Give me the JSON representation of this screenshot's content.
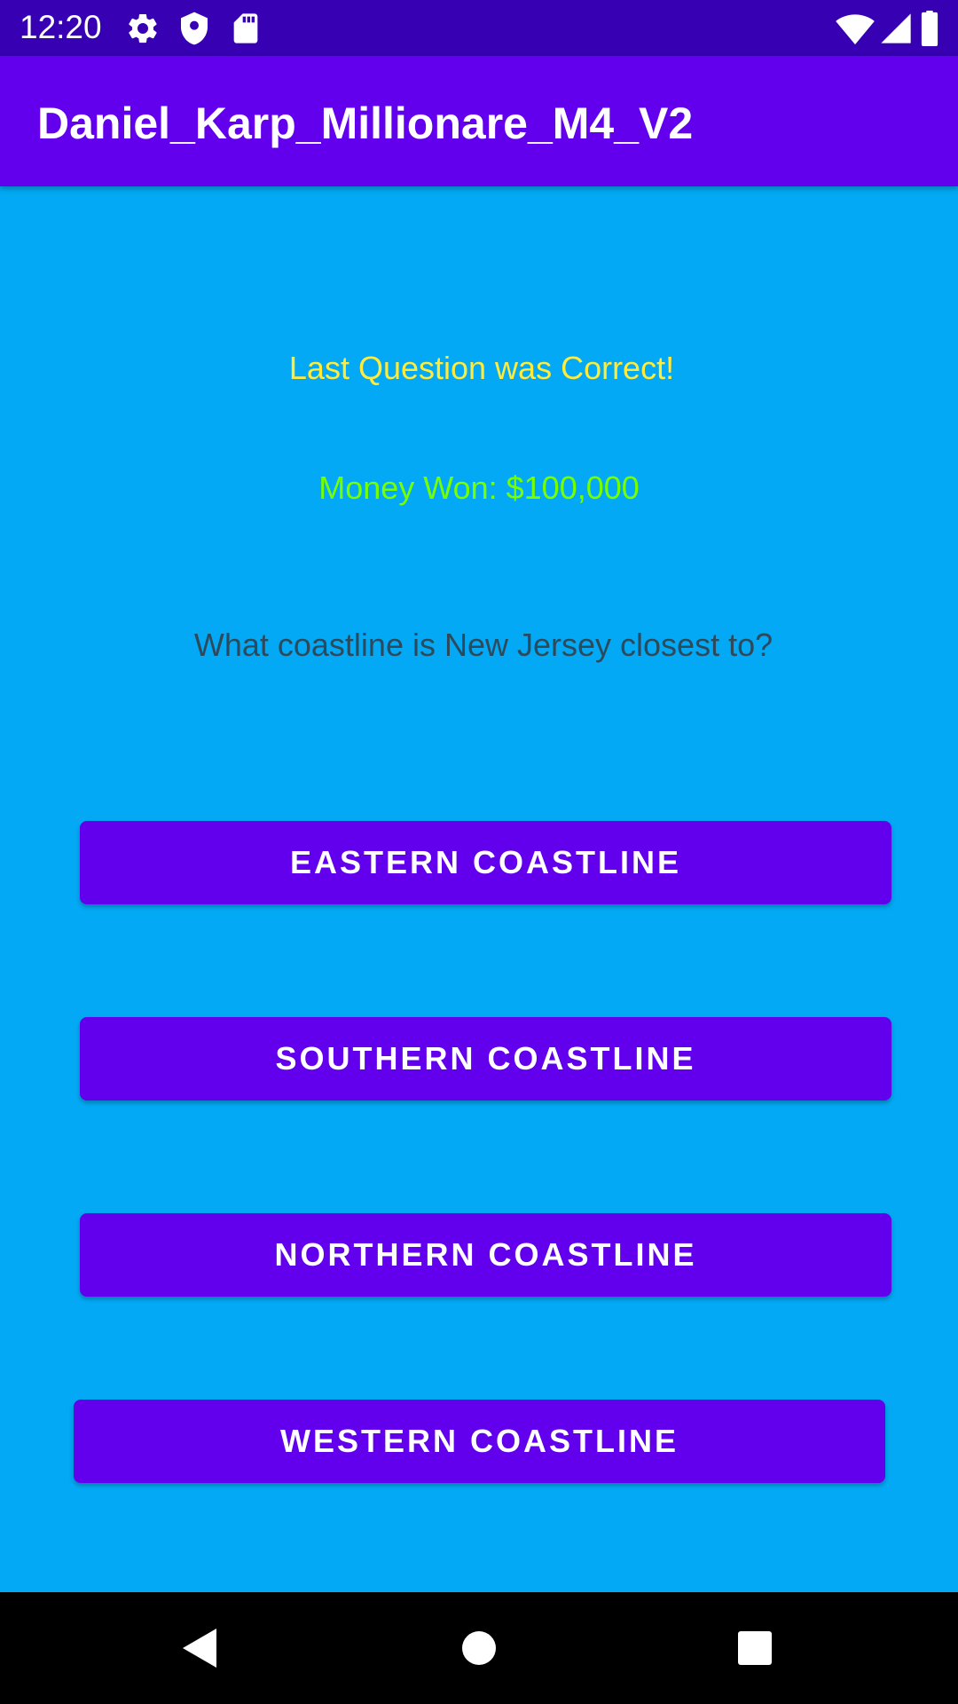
{
  "status_bar": {
    "time": "12:20",
    "icons_left": [
      "settings-icon",
      "shield-icon",
      "sd-card-icon"
    ],
    "icons_right": [
      "wifi-icon",
      "cell-signal-icon",
      "battery-icon"
    ]
  },
  "app_bar": {
    "title": "Daniel_Karp_Millionare_M4_V2"
  },
  "game": {
    "result_message": "Last Question was Correct!",
    "money_won": "Money Won: $100,000",
    "question": "What coastline is New Jersey closest to?",
    "answers": [
      "EASTERN COASTLINE",
      "SOUTHERN COASTLINE",
      "NORTHERN COASTLINE",
      "WESTERN COASTLINE"
    ]
  },
  "nav_bar": {
    "buttons": [
      "back-icon",
      "home-icon",
      "recents-icon"
    ]
  },
  "colors": {
    "background": "#03a9f4",
    "primary": "#6200ee",
    "primary_dark": "#3700b3",
    "result_text": "#ffeb3b",
    "money_text": "#76ff03"
  }
}
